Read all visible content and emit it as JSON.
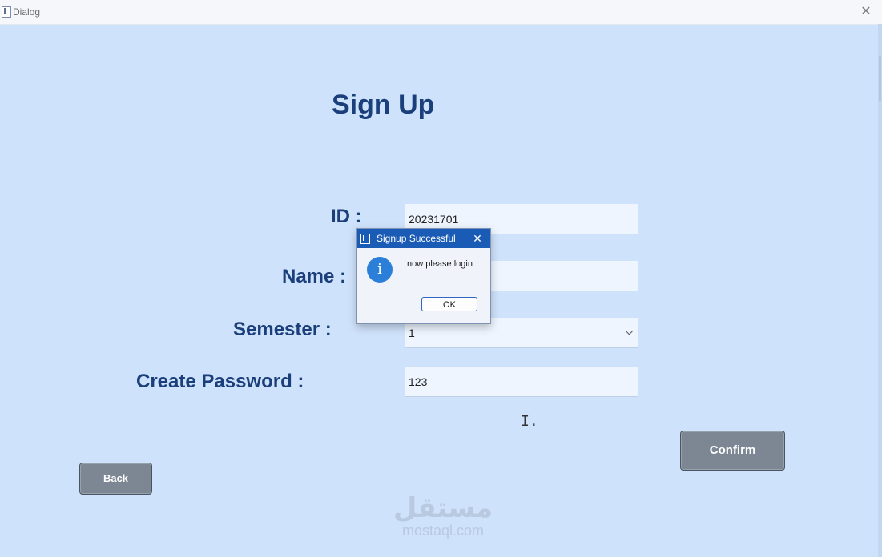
{
  "window": {
    "title": "Dialog",
    "close_glyph": "✕"
  },
  "form": {
    "heading": "Sign Up",
    "id": {
      "label": "ID :",
      "value": "20231701"
    },
    "name": {
      "label": "Name :",
      "value": ""
    },
    "semester": {
      "label": "Semester :",
      "value": "1",
      "icon": "chevron-down-icon"
    },
    "password": {
      "label": "Create Password :",
      "value": "123"
    },
    "confirm_label": "Confirm",
    "back_label": "Back",
    "text_cursor": "I."
  },
  "dialog": {
    "title": "Signup Successful",
    "close_glyph": "✕",
    "icon": "info-icon",
    "icon_glyph": "i",
    "message": "now please login",
    "ok_label": "OK"
  },
  "watermark": {
    "arabic": "مستقل",
    "latin": "mostaql.com"
  },
  "colors": {
    "background": "#cfe2fb",
    "heading": "#1b3f7a",
    "button": "#7d8794",
    "dialog_title": "#1a5bb5"
  }
}
